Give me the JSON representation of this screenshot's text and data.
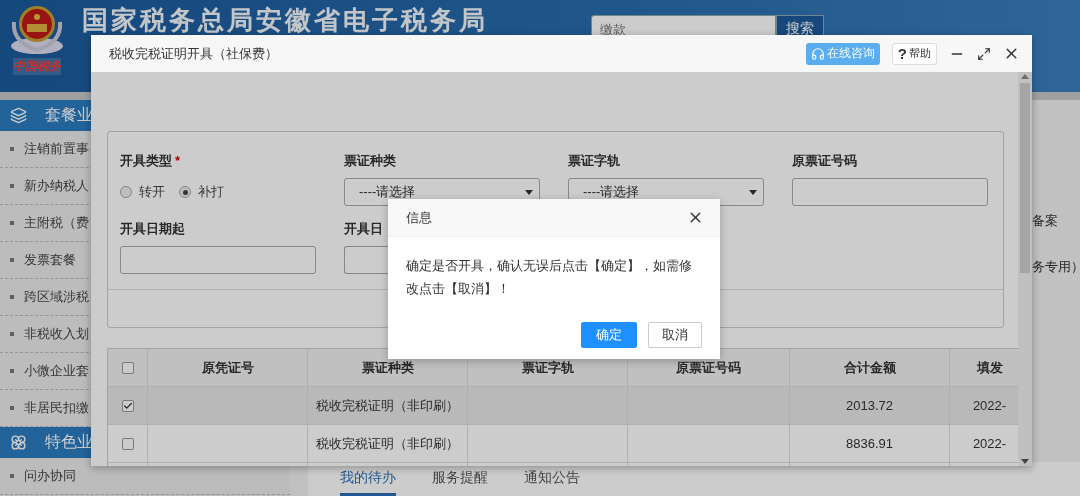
{
  "site": {
    "logo_text": "中国税务",
    "title": "国家税务总局安徽省电子税务局",
    "search": {
      "placeholder": "缴款",
      "button": "搜索"
    }
  },
  "sidebar": {
    "sections": [
      {
        "title": "套餐业",
        "items": [
          "注销前置事",
          "新办纳税人",
          "主附税（费",
          "发票套餐",
          "跨区域涉税",
          "非税收入划",
          "小微企业套",
          "非居民扣缴"
        ]
      },
      {
        "title": "特色业",
        "items": [
          "问办协同"
        ]
      }
    ]
  },
  "main": {
    "side_texts": [
      "备案",
      "务专用）"
    ],
    "tabs": [
      {
        "label": "我的待办",
        "selected": true
      },
      {
        "label": "服务提醒",
        "selected": false
      },
      {
        "label": "通知公告",
        "selected": false
      }
    ]
  },
  "modal": {
    "title": "税收完税证明开具（社保费）",
    "consult_button": "在线咨询",
    "help_button": {
      "glyph": "?",
      "label": "帮助"
    },
    "form": {
      "issue_type": {
        "label": "开具类型",
        "required_mark": "*",
        "options": [
          {
            "label": "转开",
            "selected": false
          },
          {
            "label": "补打",
            "selected": true
          }
        ]
      },
      "fields": [
        {
          "kind": "select",
          "label": "票证种类",
          "value": "----请选择"
        },
        {
          "kind": "select",
          "label": "票证字轨",
          "value": "----请选择"
        },
        {
          "kind": "input",
          "label": "原票证号码"
        },
        {
          "kind": "input",
          "label": "开具日期起"
        },
        {
          "kind": "input",
          "label": "开具日"
        }
      ]
    },
    "table": {
      "header_checked": false,
      "columns": [
        "原凭证号",
        "票证种类",
        "票证字轨",
        "原票证号码",
        "合计金额",
        "填发"
      ],
      "rows": [
        {
          "checked": true,
          "cells": [
            "",
            "税收完税证明（非印刷）",
            "",
            "",
            "2013.72",
            "2022-"
          ]
        },
        {
          "checked": false,
          "cells": [
            "",
            "税收完税证明（非印刷）",
            "",
            "",
            "8836.91",
            "2022-"
          ]
        }
      ]
    }
  },
  "dialog": {
    "title": "信息",
    "message": "确定是否开具，确认无误后点击【确定】，如需修改点击【取消】！",
    "buttons": [
      {
        "label": "确定",
        "kind": "primary"
      },
      {
        "label": "取消",
        "kind": "default"
      }
    ]
  }
}
